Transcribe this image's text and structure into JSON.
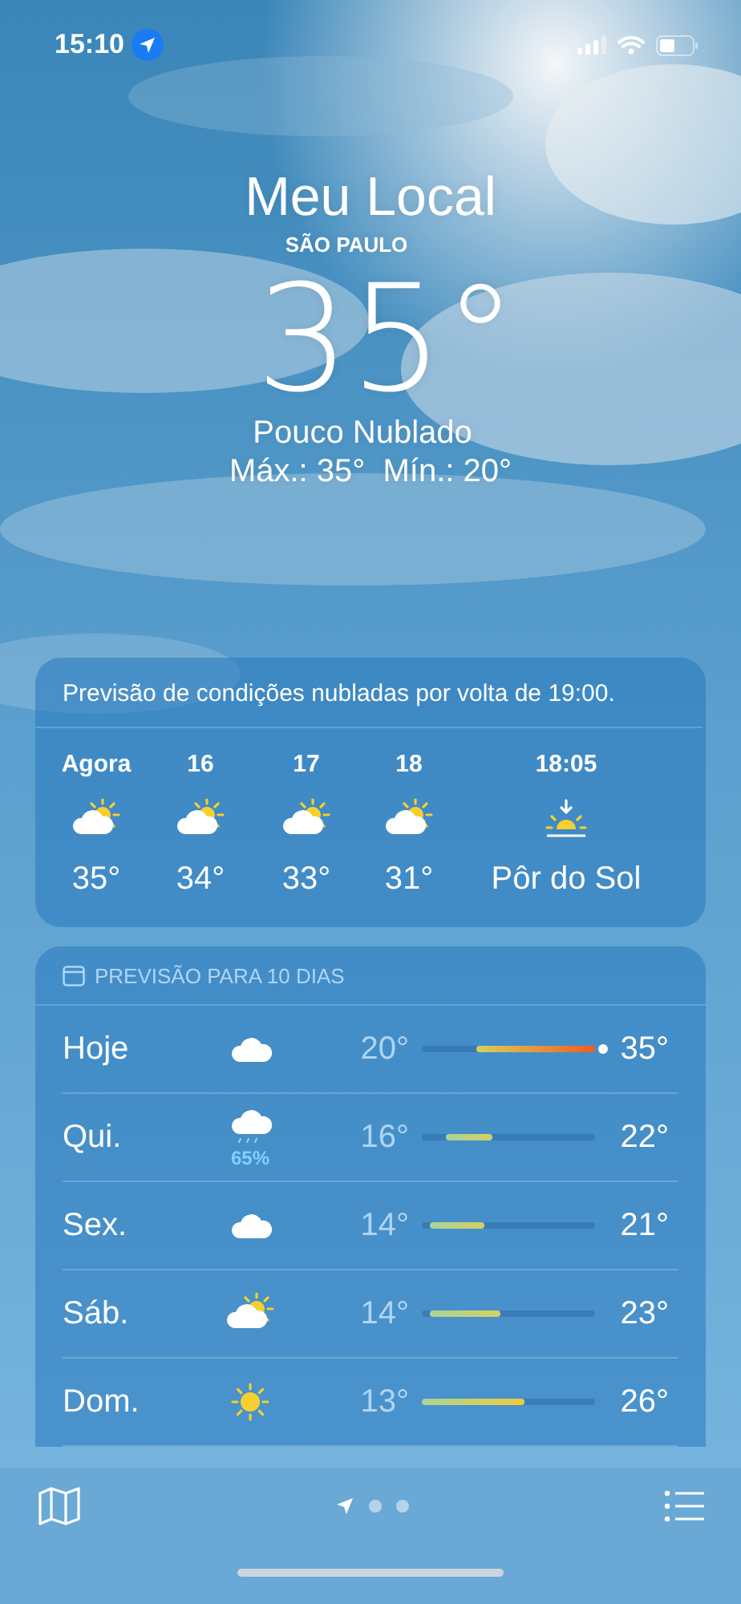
{
  "status_bar": {
    "time": "15:10",
    "location_active": true
  },
  "header": {
    "title": "Meu Local",
    "city": "SÃO PAULO",
    "temperature": "35°",
    "condition": "Pouco Nublado",
    "high_low": "Máx.: 35°  Mín.: 20°"
  },
  "hourly": {
    "summary": "Previsão de condições nubladas por volta de 19:00.",
    "items": [
      {
        "label": "Agora",
        "kind": "partly_cloudy",
        "value": "35°"
      },
      {
        "label": "16",
        "kind": "partly_cloudy",
        "value": "34°"
      },
      {
        "label": "17",
        "kind": "partly_cloudy",
        "value": "33°"
      },
      {
        "label": "18",
        "kind": "partly_cloudy",
        "value": "31°"
      },
      {
        "label": "18:05",
        "kind": "sunset",
        "value": "Pôr do Sol"
      }
    ]
  },
  "daily": {
    "title": "PREVISÃO PARA 10 DIAS",
    "days": [
      {
        "day": "Hoje",
        "kind": "cloudy",
        "low": "20°",
        "high": "35°",
        "now_marker": true
      },
      {
        "day": "Qui.",
        "kind": "rain",
        "precipitation": "65%",
        "low": "16°",
        "high": "22°",
        "now_marker": false
      },
      {
        "day": "Sex.",
        "kind": "cloudy",
        "low": "14°",
        "high": "21°",
        "now_marker": false
      },
      {
        "day": "Sáb.",
        "kind": "partly_cloudy",
        "low": "14°",
        "high": "23°",
        "now_marker": false
      },
      {
        "day": "Dom.",
        "kind": "sunny",
        "low": "13°",
        "high": "26°",
        "now_marker": false
      }
    ]
  },
  "pages": [
    {
      "kind": "location",
      "selected": true
    },
    {
      "kind": "dot",
      "selected": false
    },
    {
      "kind": "dot",
      "selected": false
    }
  ]
}
